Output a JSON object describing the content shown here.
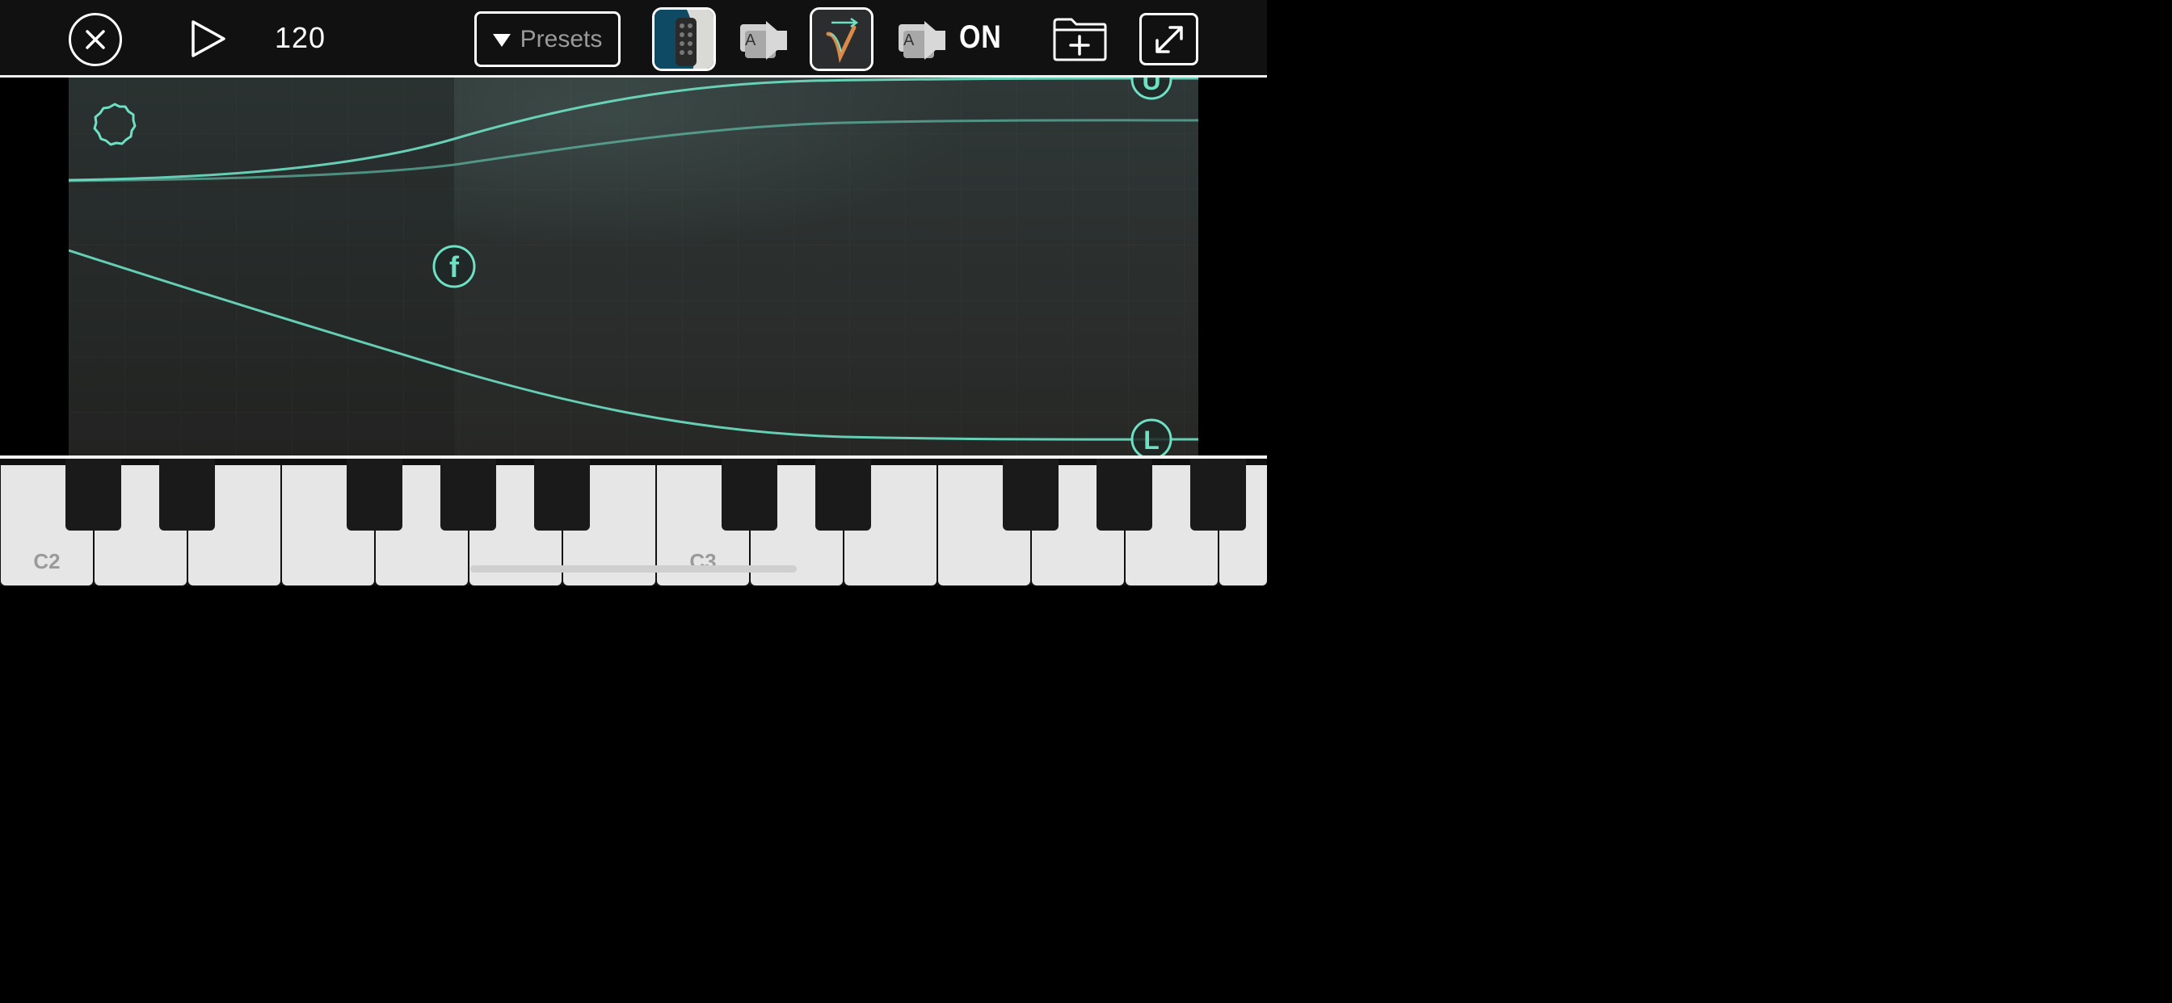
{
  "toolbar": {
    "close_icon": "close-circle-icon",
    "play_icon": "play-icon",
    "tempo": "120",
    "presets_label": "Presets",
    "plugin_thumbnail_1": "keypad-plugin-thumbnail",
    "plugin_thumbnail_2": "v-logo-plugin-thumbnail",
    "audio_unit_icon": "audio-unit-icon",
    "sync_label": "ON",
    "folder_icon": "folder-add-icon",
    "expand_icon": "expand-icon"
  },
  "panel": {
    "gear_icon": "gear-outline-icon",
    "handle_f_label": "f",
    "handle_u_label": "U",
    "handle_l_label": "L",
    "accent_color": "#6ee0c4"
  },
  "keyboard": {
    "labels": [
      "C2",
      "C3"
    ]
  }
}
